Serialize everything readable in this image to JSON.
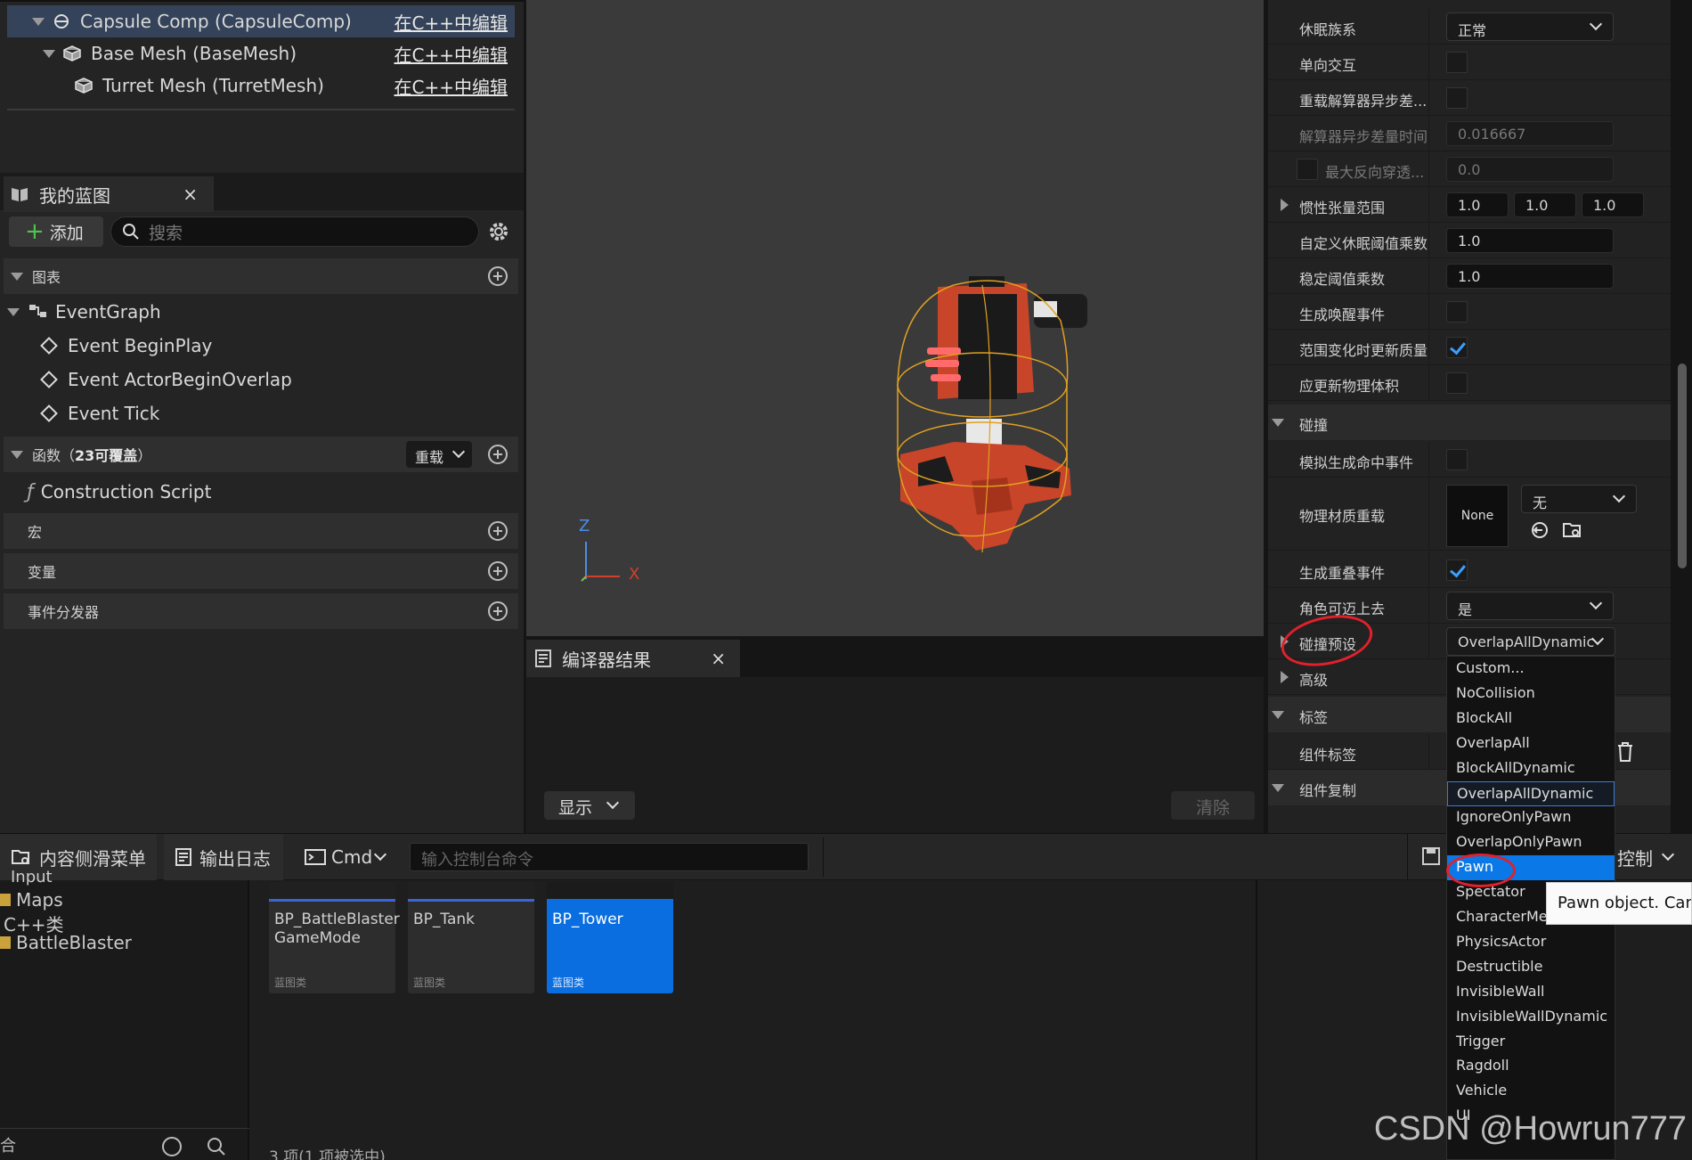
{
  "components": [
    {
      "label": "Capsule Comp (CapsuleComp)",
      "edit": "在C++中编辑"
    },
    {
      "label": "Base Mesh (BaseMesh)",
      "edit": "在C++中编辑"
    },
    {
      "label": "Turret Mesh (TurretMesh)",
      "edit": "在C++中编辑"
    }
  ],
  "my_blueprint": {
    "tab_title": "我的蓝图",
    "add_label": "添加",
    "search_placeholder": "搜索",
    "graphs_label": "图表",
    "event_graph": "EventGraph",
    "events": [
      "Event BeginPlay",
      "Event ActorBeginOverlap",
      "Event Tick"
    ],
    "functions_label": "函数",
    "functions_count": "23可覆盖",
    "override_label": "重载",
    "construction_script": "Construction Script",
    "macros_label": "宏",
    "variables_label": "变量",
    "dispatchers_label": "事件分发器"
  },
  "viewport": {
    "axis_z": "Z",
    "axis_x": "X"
  },
  "compiler": {
    "tab_title": "编译器结果",
    "show_label": "显示",
    "clear_label": "清除"
  },
  "details": {
    "rows": {
      "sleep_family": {
        "label": "休眠族系",
        "value": "正常"
      },
      "one_way": {
        "label": "单向交互"
      },
      "override_async": {
        "label": "重载解算器异步差..."
      },
      "async_delta": {
        "label": "解算器异步差量时间",
        "value": "0.016667"
      },
      "max_depen": {
        "label": "最大反向穿透...",
        "value": "0.0"
      },
      "inertia": {
        "label": "惯性张量范围",
        "x": "1.0",
        "y": "1.0",
        "z": "1.0"
      },
      "custom_sleep": {
        "label": "自定义休眠阈值乘数",
        "value": "1.0"
      },
      "stabilize": {
        "label": "稳定阈值乘数",
        "value": "1.0"
      },
      "wake_events": {
        "label": "生成唤醒事件"
      },
      "update_mass": {
        "label": "范围变化时更新质量"
      },
      "update_volume": {
        "label": "应更新物理体积"
      },
      "collision_cat": {
        "label": "碰撞"
      },
      "sim_hit": {
        "label": "模拟生成命中事件"
      },
      "phys_mat": {
        "label": "物理材质重载",
        "thumb": "None",
        "value": "无"
      },
      "overlap_events": {
        "label": "生成重叠事件"
      },
      "step_up": {
        "label": "角色可迈上去",
        "value": "是"
      },
      "preset": {
        "label": "碰撞预设",
        "value": "OverlapAllDynamic"
      },
      "advanced": {
        "label": "高级"
      },
      "tags_cat": {
        "label": "标签"
      },
      "comp_tags": {
        "label": "组件标签"
      },
      "replication_cat": {
        "label": "组件复制"
      }
    }
  },
  "preset_options": [
    "Custom...",
    "NoCollision",
    "BlockAll",
    "OverlapAll",
    "BlockAllDynamic",
    "OverlapAllDynamic",
    "IgnoreOnlyPawn",
    "OverlapOnlyPawn",
    "Pawn",
    "Spectator",
    "CharacterMesh",
    "PhysicsActor",
    "Destructible",
    "InvisibleWall",
    "InvisibleWallDynamic",
    "Trigger",
    "Ragdoll",
    "Vehicle",
    "UI"
  ],
  "preset_current": "OverlapAllDynamic",
  "preset_highlight": "Pawn",
  "tooltip": "Pawn object. Can be",
  "bottom_tabs": {
    "content_drawer": "内容侧滑菜单",
    "output_log": "输出日志",
    "cmd": "Cmd",
    "console_placeholder": "输入控制台命令",
    "control": "控制"
  },
  "folders": [
    "Input",
    "Maps",
    "C++类",
    "BattleBlaster"
  ],
  "assets": [
    {
      "name": "BP_BattleBlaster GameMode",
      "type": "蓝图类"
    },
    {
      "name": "BP_Tank",
      "type": "蓝图类"
    },
    {
      "name": "BP_Tower",
      "type": "蓝图类"
    }
  ],
  "item_count": "3 项(1 项被选中)",
  "watermark": "CSDN @Howrun777",
  "colors": {
    "accent": "#0a78e6",
    "annotation": "#e0212b",
    "turret": "#c8452a"
  }
}
